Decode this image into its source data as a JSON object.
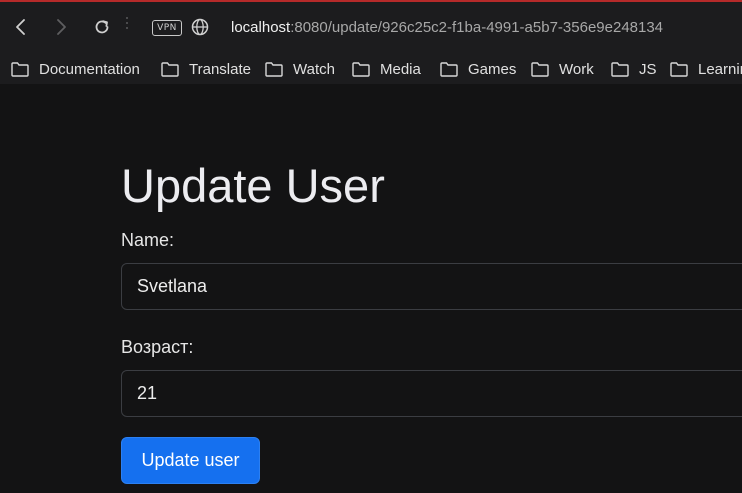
{
  "browser": {
    "vpn_label": "VPN",
    "url_host": "localhost",
    "url_rest": ":8080/update/926c25c2-f1ba-4991-a5b7-356e9e248134",
    "bookmarks": [
      {
        "label": "Documentation"
      },
      {
        "label": "Translate"
      },
      {
        "label": "Watch"
      },
      {
        "label": "Media"
      },
      {
        "label": "Games"
      },
      {
        "label": "Work"
      },
      {
        "label": "JS"
      },
      {
        "label": "Learnin"
      }
    ]
  },
  "form": {
    "title": "Update User",
    "name_label": "Name:",
    "name_value": "Svetlana",
    "age_label": "Возраст:",
    "age_value": "21",
    "submit_label": "Update user"
  },
  "colors": {
    "page_background": "#131314",
    "toolbar_background": "#1c1c1e",
    "accent": "#1570ef"
  }
}
